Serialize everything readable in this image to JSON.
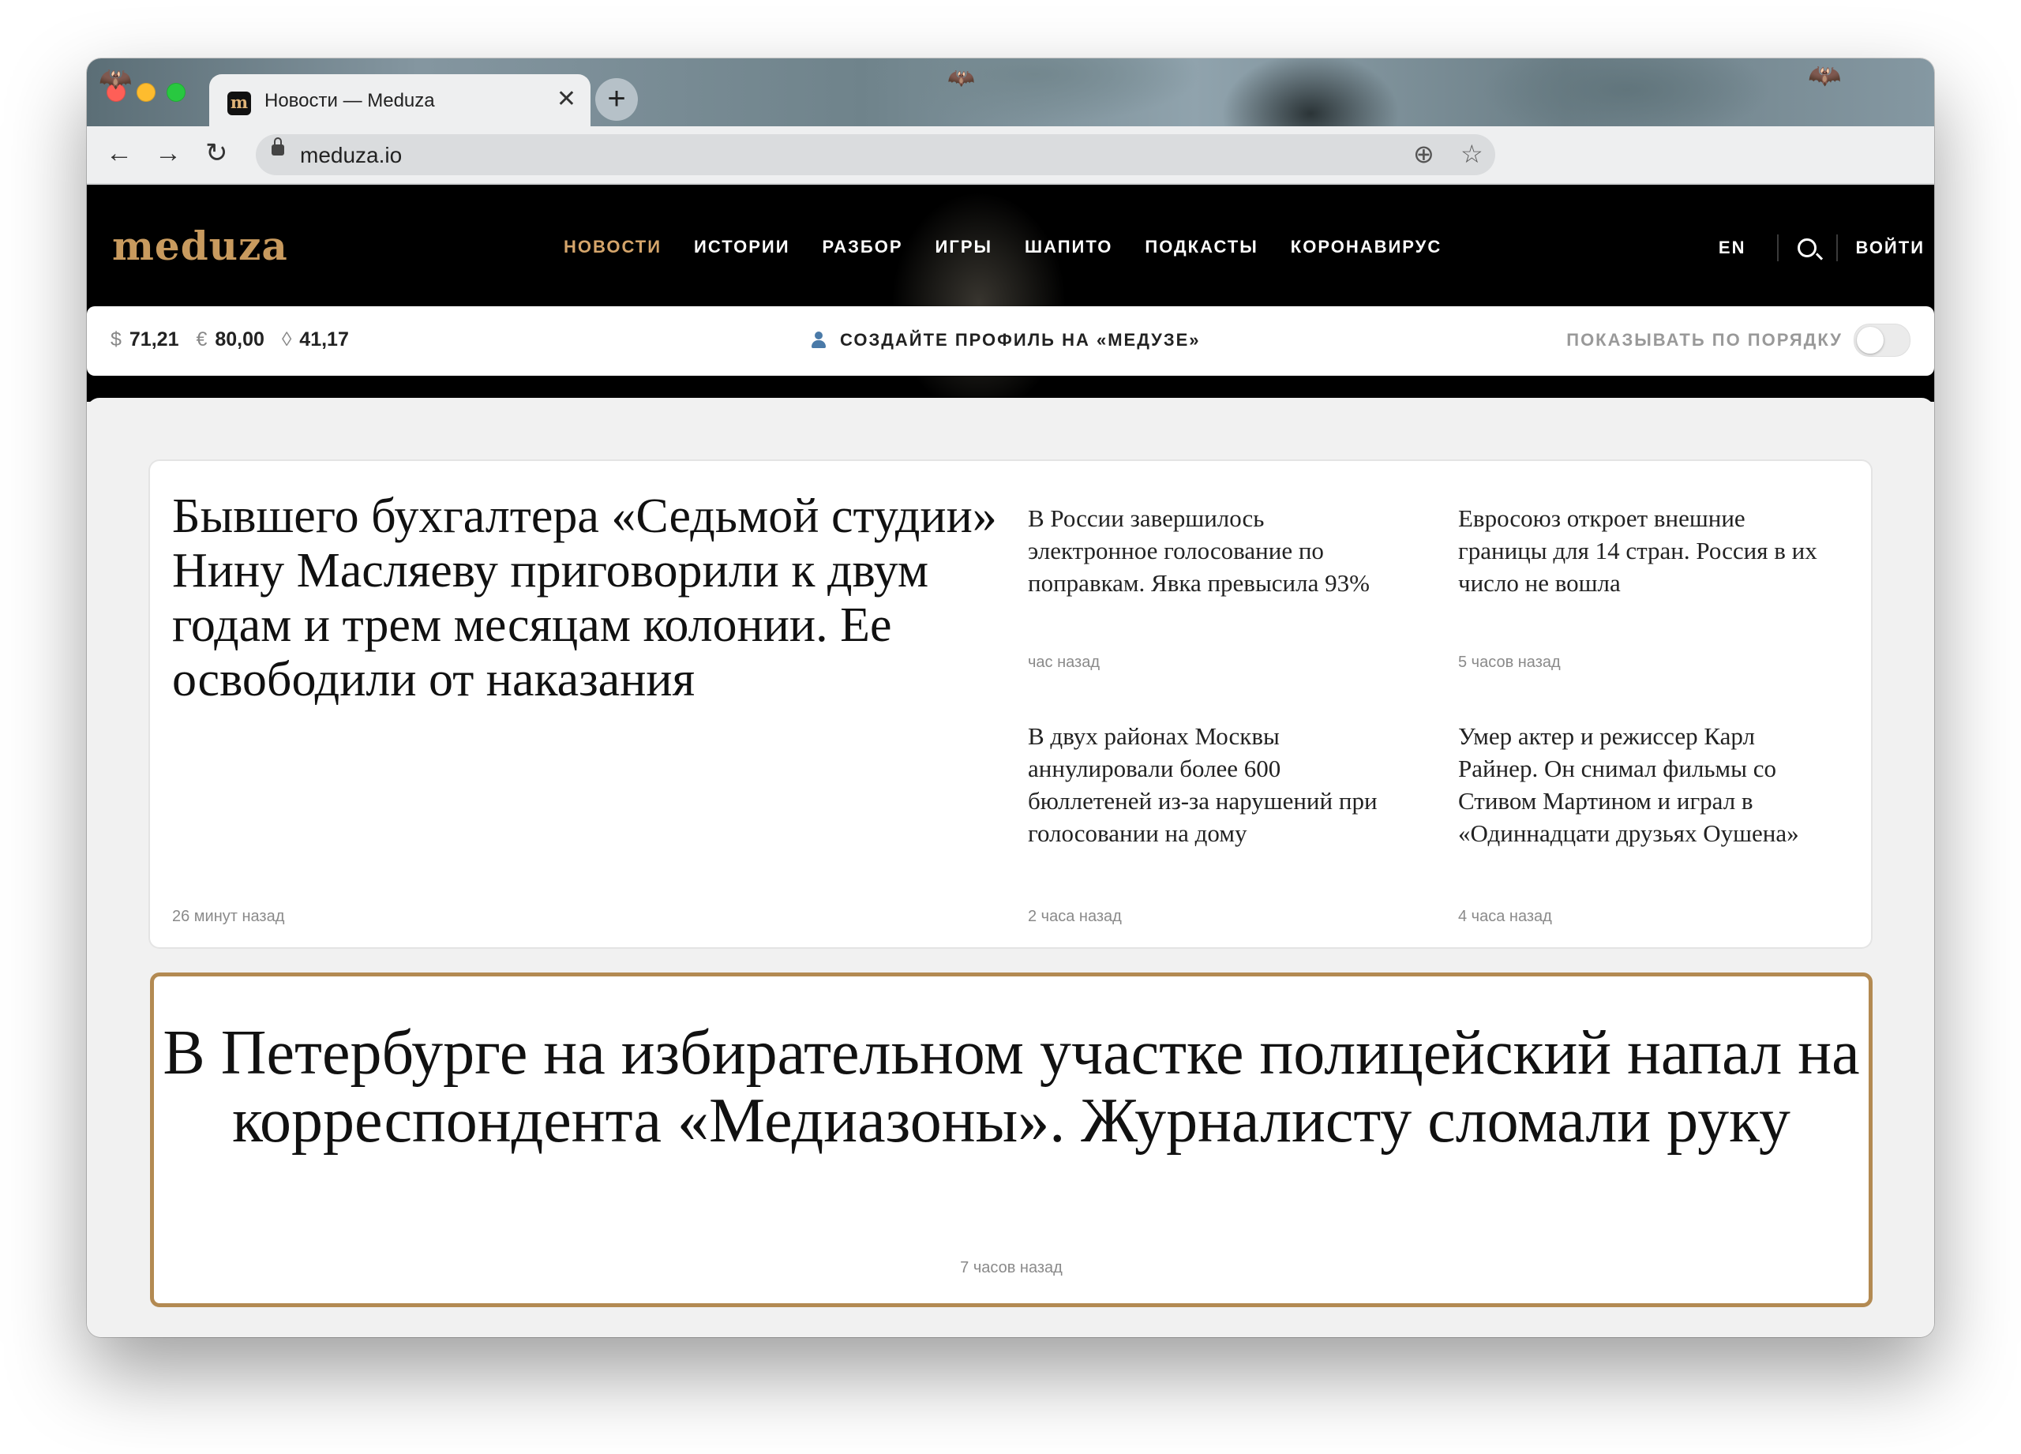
{
  "browser": {
    "tab_title": "Новости — Meduza",
    "tab_favicon": "m",
    "url": "meduza.io"
  },
  "site": {
    "logo": "meduza",
    "nav": [
      "НОВОСТИ",
      "ИСТОРИИ",
      "РАЗБОР",
      "ИГРЫ",
      "ШАПИТО",
      "ПОДКАСТЫ",
      "КОРОНАВИРУС"
    ],
    "lang": "EN",
    "login": "ВОЙТИ",
    "accent_color": "#d5a56b"
  },
  "infobar": {
    "rates": [
      {
        "symbol": "$",
        "value": "71,21"
      },
      {
        "symbol": "€",
        "value": "80,00"
      },
      {
        "symbol": "◊",
        "value": "41,17"
      }
    ],
    "profile_cta": "СОЗДАЙТЕ ПРОФИЛЬ НА «МЕДУЗЕ»",
    "order_label": "ПОКАЗЫВАТЬ ПО ПОРЯДКУ"
  },
  "news": {
    "lead": {
      "title": "Бывшего бухгалтера «Седьмой студии» Нину Масляеву приговорили к двум годам и трем месяцам колонии. Ее освободили от наказания",
      "time": "26 минут назад"
    },
    "items": [
      {
        "title": "В России завершилось электронное голосование по поправкам. Явка превысила 93%",
        "time": "час назад"
      },
      {
        "title": "Евросоюз откроет внешние границы для 14 стран. Россия в их число не вошла",
        "time": "5 часов назад"
      },
      {
        "title": "В двух районах Москвы аннулировали более 600 бюллетеней из-за нарушений при голосовании на дому",
        "time": "2 часа назад"
      },
      {
        "title": "Умер актер и режиссер Карл Райнер. Он снимал фильмы со Стивом Мартином и играл в «Одиннадцати друзьях Оушена»",
        "time": "4 часа назад"
      }
    ],
    "featured": {
      "title": "В Петербурге на избирательном участке полицейский напал на корреспондента «Медиазоны». Журналисту сломали руку",
      "time": "7 часов назад"
    }
  }
}
